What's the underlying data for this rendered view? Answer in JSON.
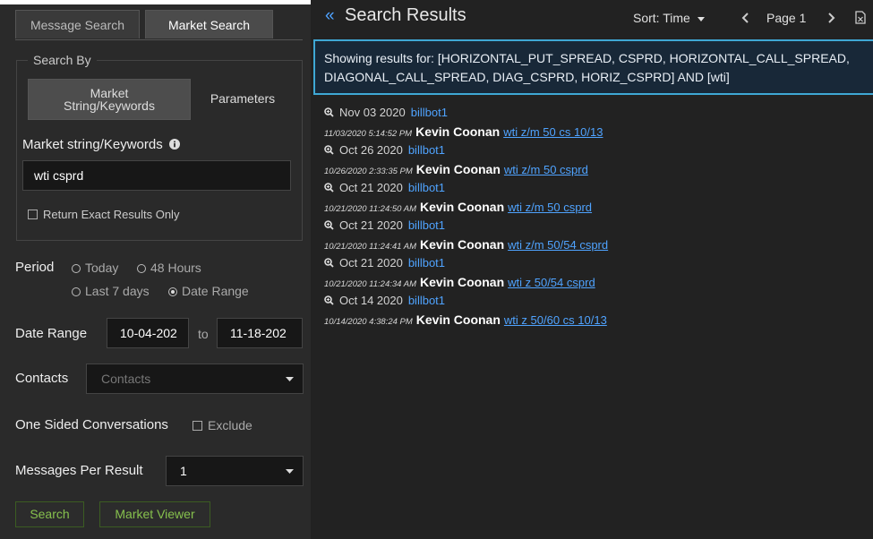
{
  "tabs": [
    {
      "label": "Message Search"
    },
    {
      "label": "Market Search"
    }
  ],
  "search_by": {
    "legend": "Search By",
    "options": [
      "Market String/Keywords",
      "Parameters"
    ],
    "selected": "Market String/Keywords"
  },
  "keywords": {
    "label": "Market string/Keywords",
    "info_icon": "info-icon",
    "value": "wti csprd"
  },
  "exact_results": {
    "label": "Return Exact Results Only",
    "checked": false
  },
  "period": {
    "label": "Period",
    "options": [
      "Today",
      "48 Hours",
      "Last 7 days",
      "Date Range"
    ],
    "selected": "Date Range"
  },
  "date_range": {
    "label": "Date Range",
    "from": "10-04-202",
    "separator": "to",
    "to": "11-18-202"
  },
  "contacts": {
    "label": "Contacts",
    "placeholder": "Contacts"
  },
  "one_sided": {
    "label": "One Sided Conversations",
    "option_label": "Exclude",
    "checked": false
  },
  "messages_per_result": {
    "label": "Messages Per Result",
    "value": "1"
  },
  "buttons": {
    "search": "Search",
    "market_viewer": "Market Viewer"
  },
  "header": {
    "collapse_icon": "«",
    "title": "Search Results",
    "sort_label": "Sort: Time",
    "page_label": "Page 1"
  },
  "notice": "Showing results for: [HORIZONTAL_PUT_SPREAD, CSPRD, HORIZONTAL_CALL_SPREAD, DIAGONAL_CALL_SPREAD, DIAG_CSPRD, HORIZ_CSPRD] AND [wti]",
  "results": [
    {
      "date": "Nov 03 2020",
      "bot": "billbot1",
      "timestamp": "11/03/2020 5:14:52 PM",
      "name": "Kevin Coonan",
      "message": "wti z/m 50 cs 10/13"
    },
    {
      "date": "Oct 26 2020",
      "bot": "billbot1",
      "timestamp": "10/26/2020 2:33:35 PM",
      "name": "Kevin Coonan",
      "message": "wti z/m 50 csprd"
    },
    {
      "date": "Oct 21 2020",
      "bot": "billbot1",
      "timestamp": "10/21/2020 11:24:50 AM",
      "name": "Kevin Coonan",
      "message": "wti z/m 50 csprd"
    },
    {
      "date": "Oct 21 2020",
      "bot": "billbot1",
      "timestamp": "10/21/2020 11:24:41 AM",
      "name": "Kevin Coonan",
      "message": "wti z/m 50/54 csprd"
    },
    {
      "date": "Oct 21 2020",
      "bot": "billbot1",
      "timestamp": "10/21/2020 11:24:34 AM",
      "name": "Kevin Coonan",
      "message": "wti z 50/54 csprd"
    },
    {
      "date": "Oct 14 2020",
      "bot": "billbot1",
      "timestamp": "10/14/2020 4:38:24 PM",
      "name": "Kevin Coonan",
      "message": "wti z 50/60 cs 10/13"
    }
  ],
  "colors": {
    "accent_link": "#4fa3ff",
    "button_green": "#86c04d",
    "notice_border": "#3fa8d5"
  }
}
